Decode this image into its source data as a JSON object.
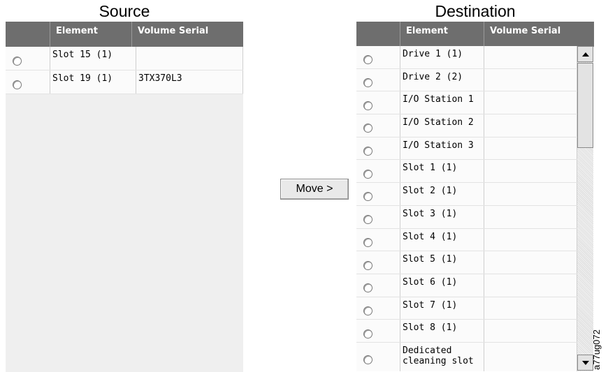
{
  "source": {
    "title": "Source",
    "columns": [
      "",
      "Element",
      "Volume Serial"
    ],
    "rows": [
      {
        "element": "Slot 15 (1)",
        "serial": ""
      },
      {
        "element": "Slot 19 (1)",
        "serial": "3TX370L3"
      }
    ]
  },
  "move_label": "Move >",
  "destination": {
    "title": "Destination",
    "columns": [
      "",
      "Element",
      "Volume Serial"
    ],
    "rows": [
      {
        "element": "Drive 1 (1)",
        "serial": ""
      },
      {
        "element": "Drive 2 (2)",
        "serial": ""
      },
      {
        "element": "I/O Station 1",
        "serial": ""
      },
      {
        "element": "I/O Station 2",
        "serial": ""
      },
      {
        "element": "I/O Station 3",
        "serial": ""
      },
      {
        "element": "Slot 1 (1)",
        "serial": ""
      },
      {
        "element": "Slot 2 (1)",
        "serial": ""
      },
      {
        "element": "Slot 3 (1)",
        "serial": ""
      },
      {
        "element": "Slot 4 (1)",
        "serial": ""
      },
      {
        "element": "Slot 5 (1)",
        "serial": ""
      },
      {
        "element": "Slot 6 (1)",
        "serial": ""
      },
      {
        "element": "Slot 7 (1)",
        "serial": ""
      },
      {
        "element": "Slot 8 (1)",
        "serial": ""
      },
      {
        "element": "Dedicated cleaning slot",
        "serial": ""
      }
    ]
  },
  "figure_id": "a77ug072"
}
